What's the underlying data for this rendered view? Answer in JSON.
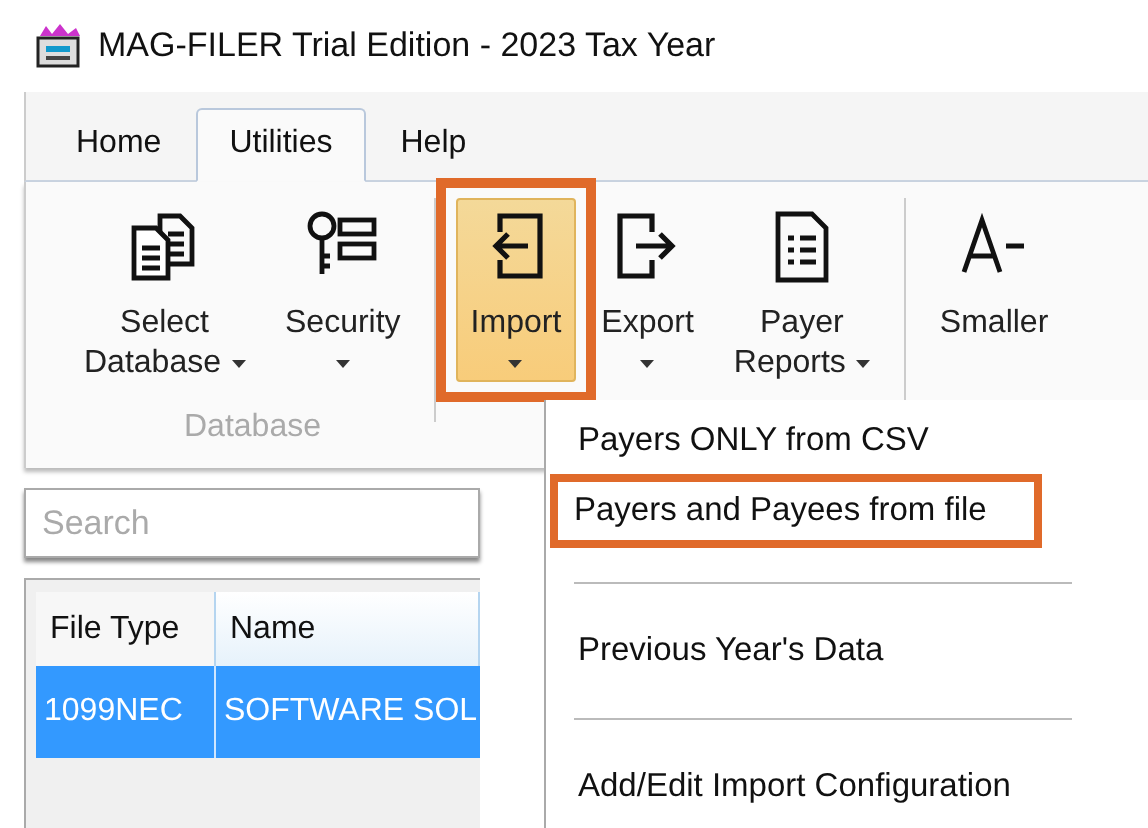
{
  "window": {
    "title": "MAG-FILER Trial Edition - 2023 Tax Year"
  },
  "tabs": [
    {
      "label": "Home",
      "selected": false
    },
    {
      "label": "Utilities",
      "selected": true
    },
    {
      "label": "Help",
      "selected": false
    }
  ],
  "ribbon": {
    "buttons": [
      {
        "kind": "database",
        "label": "Select",
        "label_2": "Database",
        "dropdown": true,
        "active": false,
        "highlighted": false
      },
      {
        "kind": "security",
        "label": "Security",
        "dropdown": true,
        "active": false,
        "highlighted": false
      },
      {
        "kind": "import",
        "label": "Import",
        "dropdown": true,
        "active": true,
        "highlighted": true
      },
      {
        "kind": "export",
        "label": "Export",
        "dropdown": true,
        "active": false,
        "highlighted": false
      },
      {
        "kind": "report",
        "label": "Payer",
        "label_2": "Reports",
        "dropdown": true,
        "active": false,
        "highlighted": false
      },
      {
        "kind": "smaller",
        "label": "Smaller",
        "dropdown": false,
        "active": false,
        "highlighted": false
      }
    ],
    "group_label": "Database"
  },
  "search": {
    "placeholder": "Search"
  },
  "table": {
    "columns": [
      "File Type",
      "Name"
    ],
    "rows": [
      {
        "cells": [
          "1099NEC",
          "SOFTWARE SOL"
        ],
        "selected": true
      }
    ]
  },
  "menu": {
    "items": [
      {
        "kind": "item",
        "label": "Payers ONLY from CSV",
        "highlighted": false
      },
      {
        "kind": "item",
        "label": "Payers and Payees from file",
        "highlighted": true
      },
      {
        "kind": "separator"
      },
      {
        "kind": "item",
        "label": "Previous Year's Data",
        "highlighted": false
      },
      {
        "kind": "separator"
      },
      {
        "kind": "item",
        "label": "Add/Edit Import Configuration",
        "highlighted": false
      }
    ]
  }
}
